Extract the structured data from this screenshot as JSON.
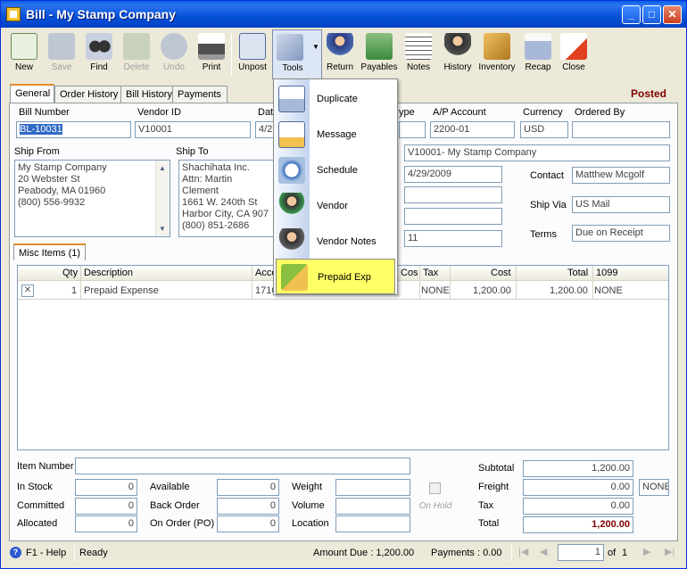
{
  "window": {
    "title": "Bill - My Stamp Company"
  },
  "toolbar": [
    {
      "label": "New",
      "icon": "new-icon",
      "disabled": false
    },
    {
      "label": "Save",
      "icon": "save-icon",
      "disabled": true
    },
    {
      "label": "Find",
      "icon": "find-icon",
      "disabled": false
    },
    {
      "label": "Delete",
      "icon": "delete-icon",
      "disabled": true
    },
    {
      "label": "Undo",
      "icon": "undo-icon",
      "disabled": true
    },
    {
      "label": "Print",
      "icon": "print-icon",
      "disabled": false
    },
    {
      "label": "Unpost",
      "icon": "unpost-icon",
      "disabled": false
    },
    {
      "label": "Tools",
      "icon": "tools-icon",
      "disabled": false
    },
    {
      "label": "Return",
      "icon": "return-icon",
      "disabled": false
    },
    {
      "label": "Payables",
      "icon": "payables-icon",
      "disabled": false
    },
    {
      "label": "Notes",
      "icon": "notes-icon",
      "disabled": false
    },
    {
      "label": "History",
      "icon": "history-icon",
      "disabled": false
    },
    {
      "label": "Inventory",
      "icon": "inventory-icon",
      "disabled": false
    },
    {
      "label": "Recap",
      "icon": "recap-icon",
      "disabled": false
    },
    {
      "label": "Close",
      "icon": "close-icon",
      "disabled": false
    }
  ],
  "tabs": [
    "General",
    "Order History",
    "Bill History",
    "Payments"
  ],
  "status": "Posted",
  "header": {
    "bill_number_label": "Bill Number",
    "bill_number": "BL-10031",
    "vendor_id_label": "Vendor ID",
    "vendor_id": "V10001",
    "date_label": "Dat",
    "date": "4/2",
    "type_label": "ype",
    "ap_account_label": "A/P Account",
    "ap_account": "2200-01",
    "currency_label": "Currency",
    "currency": "USD",
    "ordered_by_label": "Ordered By",
    "ordered_by": ""
  },
  "ship_from": {
    "label": "Ship From",
    "lines": [
      "My Stamp Company",
      "20 Webster St",
      "Peabody, MA 01960",
      "(800) 556-9932"
    ]
  },
  "ship_to": {
    "label": "Ship To",
    "lines": [
      "Shachihata Inc.",
      "Attn: Martin Clement",
      "1661 W. 240th St",
      "Harbor City, CA 907",
      "(800) 851-2686"
    ]
  },
  "vendor_info": {
    "vendor_name": "V10001- My Stamp Company",
    "due_date": "4/29/2009",
    "terms_days": "11",
    "contact_label": "Contact",
    "contact": "Matthew Mcgolf",
    "ship_via_label": "Ship Via",
    "ship_via": "US Mail",
    "terms_label": "Terms",
    "terms": "Due on Receipt"
  },
  "misc_tab": "Misc Items (1)",
  "grid": {
    "columns": [
      "Qty",
      "Description",
      "Acco",
      "Cos",
      "Tax",
      "Cost",
      "Total",
      "1099"
    ],
    "rows": [
      {
        "qty": "1",
        "description": "Prepaid Expense",
        "account": "1710",
        "tax": "NONE",
        "cost": "1,200.00",
        "total": "1,200.00",
        "f1099": "NONE"
      }
    ]
  },
  "footer": {
    "item_number_label": "Item Number",
    "item_number": "",
    "in_stock_label": "In Stock",
    "in_stock": "0",
    "committed_label": "Committed",
    "committed": "0",
    "allocated_label": "Allocated",
    "allocated": "0",
    "available_label": "Available",
    "available": "0",
    "back_order_label": "Back Order",
    "back_order": "0",
    "on_order_label": "On Order (PO)",
    "on_order": "0",
    "weight_label": "Weight",
    "weight": "",
    "volume_label": "Volume",
    "volume": "",
    "location_label": "Location",
    "location": "",
    "on_hold_label": "On Hold",
    "subtotal_label": "Subtotal",
    "subtotal": "1,200.00",
    "freight_label": "Freight",
    "freight": "0.00",
    "freight_code": "NONE",
    "tax_label": "Tax",
    "tax": "0.00",
    "total_label": "Total",
    "total": "1,200.00"
  },
  "statusbar": {
    "help": "F1 - Help",
    "state": "Ready",
    "amount_due": "Amount Due : 1,200.00",
    "payments": "Payments : 0.00",
    "page": "1",
    "of": "of",
    "page_count": "1"
  },
  "tools_menu": [
    {
      "label": "Duplicate",
      "icon": "duplicate-icon"
    },
    {
      "label": "Message",
      "icon": "message-icon"
    },
    {
      "label": "Schedule",
      "icon": "schedule-icon"
    },
    {
      "label": "Vendor",
      "icon": "vendor-icon"
    },
    {
      "label": "Vendor Notes",
      "icon": "vendor-notes-icon"
    },
    {
      "label": "Prepaid Exp",
      "icon": "prepaid-exp-icon",
      "highlighted": true
    }
  ]
}
